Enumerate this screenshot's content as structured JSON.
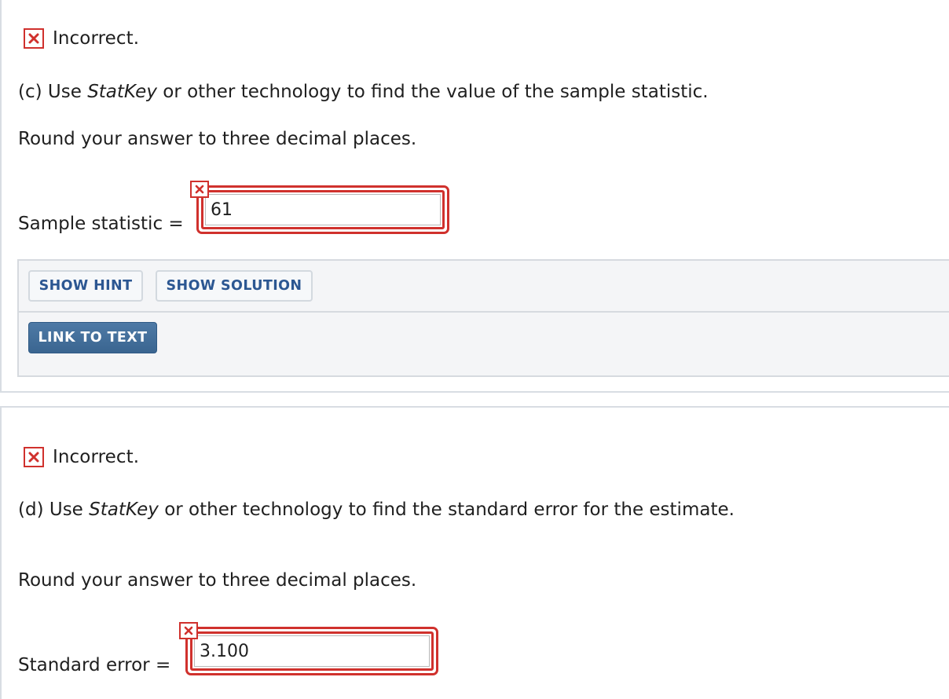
{
  "part_c": {
    "status": "Incorrect.",
    "prompt_prefix": "(c) Use ",
    "prompt_italic": "StatKey",
    "prompt_suffix": " or other technology to find the value of the sample statistic.",
    "instruction": "Round your answer to three decimal places.",
    "field_label": "Sample statistic",
    "equals": "=",
    "answer_value": "61",
    "answer_correct": false
  },
  "help_panel": {
    "show_hint_label": "SHOW HINT",
    "show_solution_label": "SHOW SOLUTION",
    "link_to_text_label": "LINK TO TEXT"
  },
  "part_d": {
    "status": "Incorrect.",
    "prompt_prefix": "(d) Use ",
    "prompt_italic": "StatKey",
    "prompt_suffix": " or other technology to find the standard error for the estimate.",
    "instruction": "Round your answer to three decimal places.",
    "field_label": "Standard error",
    "equals": "=",
    "answer_value": "3.100",
    "answer_correct": false
  },
  "colors": {
    "incorrect_red": "#d0312d",
    "button_text_blue": "#2c5792",
    "dark_button_blue": "#3f6a95",
    "panel_bg": "#f4f5f7"
  },
  "icons": {
    "incorrect": "incorrect-x-icon"
  }
}
